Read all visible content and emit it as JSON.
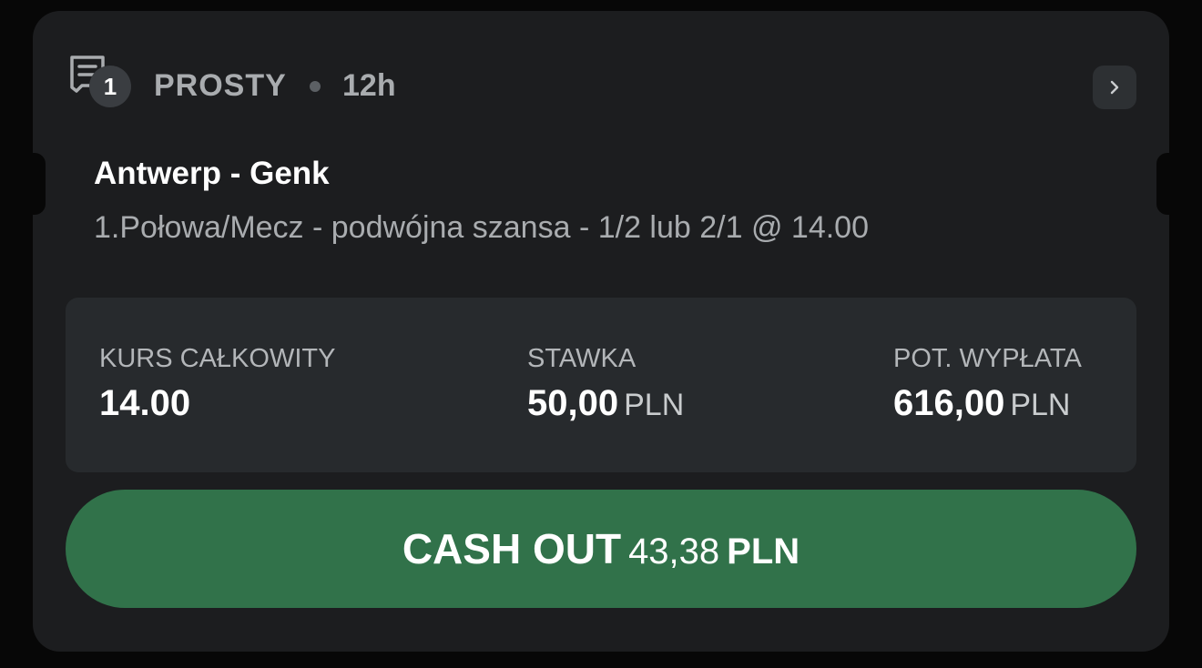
{
  "header": {
    "slip_icon": "receipt-icon",
    "count": "1",
    "bet_type": "PROSTY",
    "time": "12h",
    "chevron_icon": "chevron-right-icon"
  },
  "event": {
    "title": "Antwerp - Genk",
    "selection": "1.Połowa/Mecz - podwójna szansa - 1/2 lub 2/1 @ 14.00"
  },
  "stats": {
    "odds_label": "KURS CAŁKOWITY",
    "odds_value": "14.00",
    "stake_label": "STAWKA",
    "stake_value": "50,00",
    "stake_currency": "PLN",
    "payout_label": "POT. WYPŁATA",
    "payout_value": "616,00",
    "payout_currency": "PLN"
  },
  "cashout": {
    "label": "CASH OUT",
    "amount": "43,38",
    "currency": "PLN"
  },
  "colors": {
    "card_bg": "#1c1d1f",
    "stats_bg": "#272a2d",
    "cashout_green": "#31724a",
    "muted_text": "#a9acaf"
  }
}
